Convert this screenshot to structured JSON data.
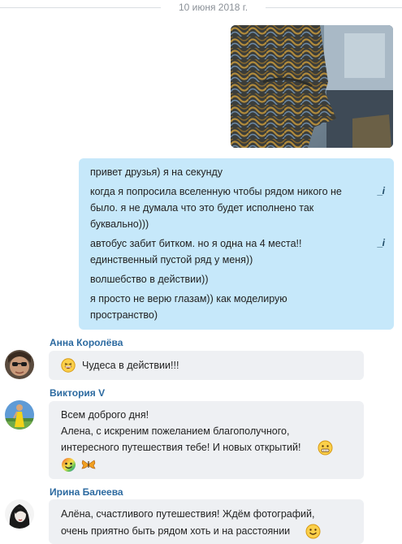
{
  "date_divider": "10 июня 2018 г.",
  "outgoing": {
    "lines": [
      "привет друзья) я на секунду",
      "когда я попросила вселенную чтобы рядом никого не",
      "было. я не думала что это будет исполнено так",
      "буквально)))",
      "автобус забит битком. но я одна на 4 места!!",
      "единственный пустой ряд у меня))",
      "волшебство в действии))",
      "я просто не верю глазам)) как моделирую",
      "пространство)"
    ],
    "edit_mark": "_i"
  },
  "messages": [
    {
      "sender": "Анна Королёва",
      "lines": [
        "Чудеса в действии!!!"
      ]
    },
    {
      "sender": "Виктория V",
      "lines": [
        "Всем доброго дня!",
        "Алена, с искреним пожеланием благополучного,",
        "интересного путешествия тебе! И  новых открытий!"
      ]
    },
    {
      "sender": "Ирина Балеева",
      "lines": [
        "Алёна, счастливого путешествия! Ждём фотографий,",
        "очень приятно быть рядом хоть и на расстоянии"
      ]
    }
  ],
  "icons": {
    "laughing": "laughing-emoji-icon",
    "smile": "smile-emoji-icon",
    "rainbow": "rainbow-face-emoji-icon",
    "butterfly": "butterfly-emoji-icon",
    "yum": "yum-emoji-icon"
  }
}
